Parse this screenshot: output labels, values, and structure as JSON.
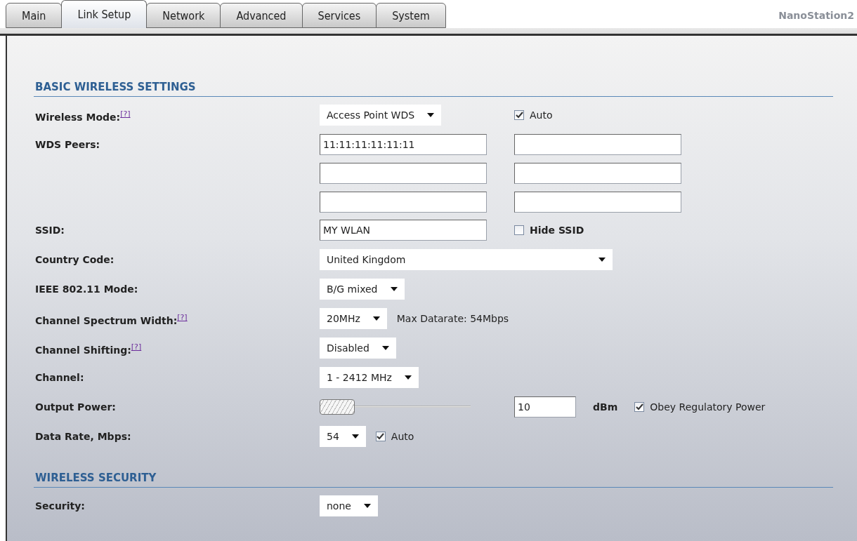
{
  "tabs": [
    {
      "label": "Main",
      "selected": false
    },
    {
      "label": "Link Setup",
      "selected": true
    },
    {
      "label": "Network",
      "selected": false
    },
    {
      "label": "Advanced",
      "selected": false
    },
    {
      "label": "Services",
      "selected": false
    },
    {
      "label": "System",
      "selected": false
    }
  ],
  "device_name": "NanoStation2",
  "sections": [
    {
      "title": "BASIC WIRELESS SETTINGS",
      "rows": [
        {
          "label": "Wireless Mode:",
          "help": "[?]",
          "kind": "paired",
          "controls": [
            {
              "kind": "select",
              "value": "Access Point WDS"
            },
            {
              "kind": "checkbox",
              "label": "Auto",
              "checked": true
            }
          ]
        },
        {
          "label": "WDS Peers:",
          "kind": "grid",
          "controls": [
            {
              "kind": "input",
              "value": "11:11:11:11:11:11"
            },
            {
              "kind": "input"
            },
            {
              "kind": "input"
            },
            {
              "kind": "input"
            },
            {
              "kind": "input"
            },
            {
              "kind": "input"
            }
          ]
        },
        {
          "label": "SSID:",
          "kind": "paired",
          "controls": [
            {
              "kind": "input",
              "value": "MY WLAN"
            },
            {
              "kind": "checkbox",
              "label": "Hide SSID",
              "checked": false,
              "bold": true
            }
          ]
        },
        {
          "label": "Country Code:",
          "kind": "inline",
          "controls": [
            {
              "kind": "wide-select",
              "value": "United Kingdom"
            }
          ]
        },
        {
          "label": "IEEE 802.11 Mode:",
          "kind": "inline",
          "controls": [
            {
              "kind": "select",
              "value": "B/G mixed"
            }
          ]
        },
        {
          "label": "Channel Spectrum Width:",
          "help": "[?]",
          "kind": "inline",
          "controls": [
            {
              "kind": "select",
              "value": "20MHz"
            },
            {
              "kind": "text",
              "value": "Max Datarate: 54Mbps"
            }
          ]
        },
        {
          "label": "Channel Shifting:",
          "help": "[?]",
          "kind": "inline",
          "controls": [
            {
              "kind": "select",
              "value": "Disabled"
            }
          ]
        },
        {
          "label": "Channel:",
          "kind": "inline",
          "controls": [
            {
              "kind": "select",
              "value": "1 - 2412 MHz"
            }
          ]
        },
        {
          "label": "Output Power:",
          "kind": "paired",
          "controls": [
            {
              "kind": "slider",
              "level": 0.0
            },
            {
              "kind": "power",
              "value": "10",
              "unit": "dBm",
              "checkbox": {
                "label": "Obey Regulatory Power",
                "checked": true
              }
            }
          ]
        },
        {
          "label": "Data Rate, Mbps:",
          "kind": "inline",
          "controls": [
            {
              "kind": "select",
              "value": "54"
            },
            {
              "kind": "checkbox",
              "label": "Auto",
              "checked": true
            }
          ]
        }
      ]
    },
    {
      "title": "WIRELESS SECURITY",
      "rows": [
        {
          "label": "Security:",
          "kind": "inline",
          "controls": [
            {
              "kind": "select",
              "value": "none"
            }
          ]
        }
      ]
    }
  ]
}
